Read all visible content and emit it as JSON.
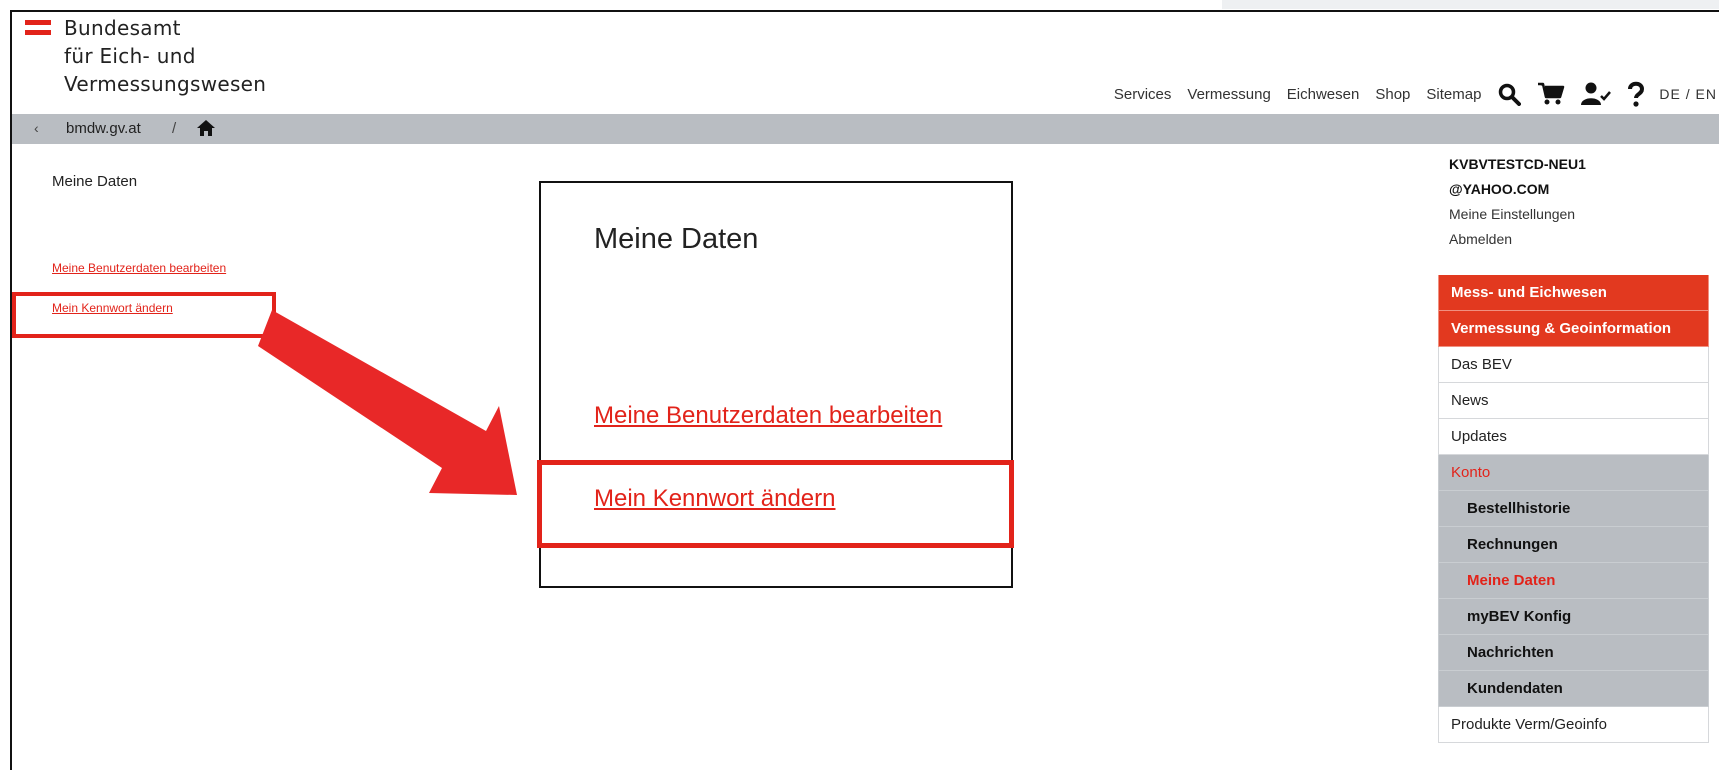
{
  "brand": {
    "lines": [
      "Bundesamt",
      "für Eich- und",
      "Vermessungswesen"
    ],
    "flag_color": "#e2231a"
  },
  "topnav": {
    "links": [
      "Services",
      "Vermessung",
      "Eichwesen",
      "Shop",
      "Sitemap"
    ],
    "icons": [
      "search-icon",
      "cart-icon",
      "user-check-icon",
      "help-icon"
    ],
    "lang": "DE / EN"
  },
  "breadcrumb": {
    "back": "‹",
    "site": "bmdw.gv.at",
    "separator": "/",
    "home_icon": "home-icon"
  },
  "left": {
    "title": "Meine Daten",
    "links": [
      "Meine Benutzerdaten bearbeiten",
      "Mein Kennwort ändern"
    ]
  },
  "zoom": {
    "title": "Meine Daten",
    "links": [
      "Meine Benutzerdaten bearbeiten",
      "Mein Kennwort ändern"
    ]
  },
  "user": {
    "name_line1": "KVBVTESTCD-NEU1",
    "name_line2": "@YAHOO.COM",
    "settings": "Meine Einstellungen",
    "logout": "Abmelden"
  },
  "menu": {
    "items": [
      "Mess- und Eichwesen",
      "Vermessung & Geoinformation",
      "Das BEV",
      "News",
      "Updates",
      "Konto",
      "Bestellhistorie",
      "Rechnungen",
      "Meine Daten",
      "myBEV Konfig",
      "Nachrichten",
      "Kundendaten",
      "Produkte Verm/Geoinfo"
    ]
  },
  "colors": {
    "accent": "#e2231a",
    "breadcrumb_bg": "#b9bdc2",
    "menu_red": "#e2391f"
  }
}
